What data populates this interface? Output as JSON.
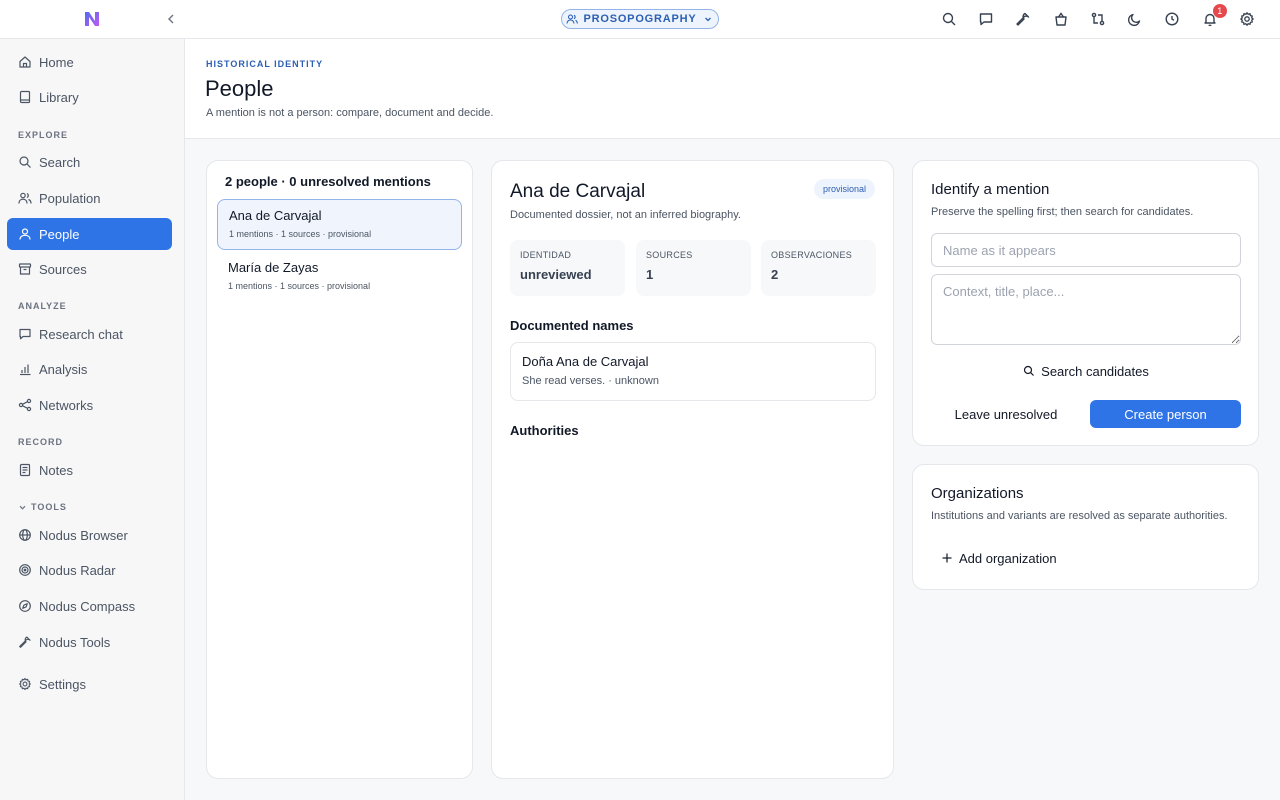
{
  "topbar": {
    "context": "PROSOPOGRAPHY",
    "notifications_count": "1",
    "icons": [
      "search-icon",
      "chat-icon",
      "wrench-icon",
      "bag-icon",
      "git-compare-icon",
      "moon-icon",
      "clock-icon",
      "bell-icon",
      "gear-icon"
    ]
  },
  "sidebar": {
    "home": "Home",
    "library": "Library",
    "section_explore": "EXPLORE",
    "search": "Search",
    "population": "Population",
    "people": "People",
    "sources": "Sources",
    "section_analyze": "ANALYZE",
    "research_chat": "Research chat",
    "analysis": "Analysis",
    "networks": "Networks",
    "section_record": "RECORD",
    "notes": "Notes",
    "section_tools": "TOOLS",
    "nodus_browser": "Nodus Browser",
    "nodus_radar": "Nodus Radar",
    "nodus_compass": "Nodus Compass",
    "nodus_tools": "Nodus Tools",
    "settings": "Settings"
  },
  "header": {
    "eyebrow": "HISTORICAL IDENTITY",
    "title": "People",
    "subtitle": "A mention is not a person: compare, document and decide."
  },
  "people_list": {
    "heading": "2 people · 0 unresolved mentions",
    "items": [
      {
        "name": "Ana de Carvajal",
        "meta": "1 mentions · 1 sources · provisional"
      },
      {
        "name": "María de Zayas",
        "meta": "1 mentions · 1 sources · provisional"
      }
    ]
  },
  "detail": {
    "name": "Ana de Carvajal",
    "subtitle": "Documented dossier, not an inferred biography.",
    "status": "provisional",
    "stats": [
      {
        "label": "IDENTIDAD",
        "value": "unreviewed"
      },
      {
        "label": "SOURCES",
        "value": "1"
      },
      {
        "label": "OBSERVACIONES",
        "value": "2"
      }
    ],
    "documented_names_label": "Documented names",
    "documented_names": [
      {
        "name": "Doña Ana de Carvajal",
        "note": "She read verses. · unknown"
      }
    ],
    "authorities_label": "Authorities"
  },
  "identify": {
    "title": "Identify a mention",
    "subtitle": "Preserve the spelling first; then search for candidates.",
    "name_placeholder": "Name as it appears",
    "context_placeholder": "Context, title, place...",
    "search_label": "Search candidates",
    "leave_label": "Leave unresolved",
    "create_label": "Create person"
  },
  "orgs": {
    "title": "Organizations",
    "subtitle": "Institutions and variants are resolved as separate authorities.",
    "add_label": "Add organization"
  },
  "colors": {
    "accent": "#2f74e6",
    "accent_text": "#2c5fb3",
    "badge": "#e5484d"
  }
}
